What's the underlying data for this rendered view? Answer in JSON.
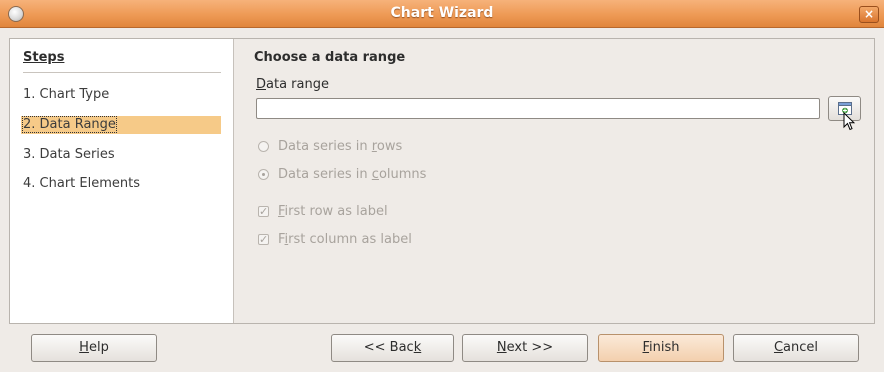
{
  "window": {
    "title": "Chart Wizard",
    "close_glyph": "×"
  },
  "sidebar": {
    "heading": "Steps",
    "steps": [
      {
        "label": "1. Chart Type",
        "active": false
      },
      {
        "label": "2. Data Range",
        "active": true
      },
      {
        "label": "3. Data Series",
        "active": false
      },
      {
        "label": "4. Chart Elements",
        "active": false
      }
    ]
  },
  "content": {
    "heading": "Choose a data range",
    "data_range": {
      "label_mnemonic": "D",
      "label_rest": "ata range",
      "value": "",
      "shrink_button_icon": "select-range-icon"
    },
    "options": {
      "rows": {
        "pre": "Data series in ",
        "mn": "r",
        "post": "ows",
        "checked": false,
        "enabled": false
      },
      "columns": {
        "pre": "Data series in ",
        "mn": "c",
        "post": "olumns",
        "checked": true,
        "enabled": false
      },
      "first_row": {
        "pre": "",
        "mn": "F",
        "post": "irst row as label",
        "checked": true,
        "enabled": false
      },
      "first_col": {
        "pre": "F",
        "mn": "i",
        "post": "rst column as label",
        "checked": true,
        "enabled": false
      }
    }
  },
  "buttons": {
    "help": {
      "pre": "",
      "mn": "H",
      "post": "elp"
    },
    "back": {
      "pre": "<< Bac",
      "mn": "k",
      "post": ""
    },
    "next": {
      "pre": "",
      "mn": "N",
      "post": "ext >>"
    },
    "finish": {
      "pre": "",
      "mn": "F",
      "post": "inish"
    },
    "cancel": {
      "pre": "",
      "mn": "C",
      "post": "ancel"
    }
  },
  "colors": {
    "titlebar": "#ee9a55",
    "active_step": "#f6ca88",
    "disabled_text": "#a8a39d"
  }
}
